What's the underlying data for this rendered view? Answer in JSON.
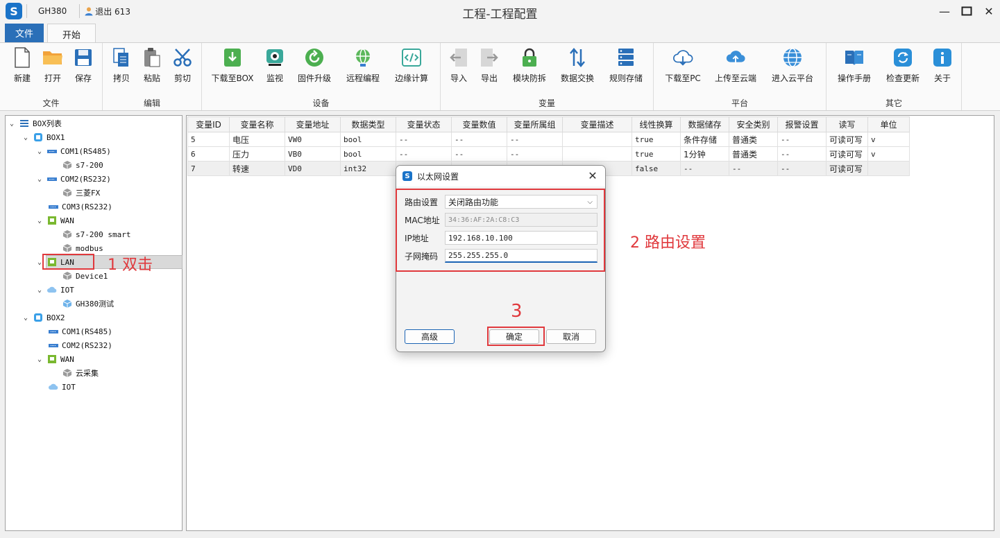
{
  "titlebar": {
    "box": "GH380",
    "user": "退出 613",
    "title": "工程-工程配置",
    "minimize": "—",
    "maximize": "☐",
    "close": "✕"
  },
  "tabs": {
    "file": "文件",
    "start": "开始"
  },
  "ribbon": {
    "groups": {
      "file": "文件",
      "edit": "编辑",
      "device": "设备",
      "variable": "变量",
      "platform": "平台",
      "other": "其它"
    },
    "buttons": {
      "new": "新建",
      "open": "打开",
      "save": "保存",
      "copy": "拷贝",
      "paste": "粘贴",
      "cut": "剪切",
      "download_box": "下载至BOX",
      "monitor": "监视",
      "firmware": "固件升级",
      "remote": "远程编程",
      "edge": "边缘计算",
      "import": "导入",
      "export": "导出",
      "module_protect": "模块防拆",
      "data_exchange": "数据交换",
      "rule_store": "规则存储",
      "download_pc": "下载至PC",
      "upload_cloud": "上传至云端",
      "enter_cloud": "进入云平台",
      "manual": "操作手册",
      "check_update": "检查更新",
      "about": "关于"
    }
  },
  "tree": {
    "root": "BOX列表",
    "box1": "BOX1",
    "com1": "COM1(RS485)",
    "s7200": "s7-200",
    "com2": "COM2(RS232)",
    "mitsubishi": "三菱FX",
    "com3": "COM3(RS232)",
    "wan": "WAN",
    "s7200smart": "s7-200 smart",
    "modbus": "modbus",
    "lan": "LAN",
    "device1": "Device1",
    "iot": "IOT",
    "gh380test": "GH380测试",
    "box2": "BOX2",
    "b2com1": "COM1(RS485)",
    "b2com2": "COM2(RS232)",
    "b2wan": "WAN",
    "cloud_collect": "云采集",
    "b2iot": "IOT"
  },
  "table": {
    "headers": [
      "变量ID",
      "变量名称",
      "变量地址",
      "数据类型",
      "变量状态",
      "变量数值",
      "变量所属组",
      "变量描述",
      "线性换算",
      "数据储存",
      "安全类别",
      "报警设置",
      "读写",
      "单位"
    ],
    "rows": [
      [
        "5",
        "电压",
        "VW0",
        "bool",
        "--",
        "--",
        "--",
        "",
        "true",
        "条件存储",
        "普通类",
        "--",
        "可读可写",
        "v"
      ],
      [
        "6",
        "压力",
        "VB0",
        "bool",
        "--",
        "--",
        "--",
        "",
        "true",
        "1分钟",
        "普通类",
        "--",
        "可读可写",
        "v"
      ],
      [
        "7",
        "转速",
        "VD0",
        "int32",
        "",
        "",
        "",
        "",
        "false",
        "--",
        "--",
        "--",
        "可读可写",
        ""
      ]
    ]
  },
  "dialog": {
    "title": "以太网设置",
    "close": "✕",
    "route_label": "路由设置",
    "route_value": "关闭路由功能",
    "mac_label": "MAC地址",
    "mac_value": "34:36:AF:2A:C8:C3",
    "ip_label": "IP地址",
    "ip_value": "192.168.10.100",
    "mask_label": "子网掩码",
    "mask_value": "255.255.255.0",
    "advanced": "高级",
    "ok": "确定",
    "cancel": "取消"
  },
  "annotations": {
    "step1": "1 双击",
    "step2": "2 路由设置",
    "step3": "3"
  },
  "colors": {
    "accent": "#1a73c8",
    "annotation": "#e0383c"
  }
}
